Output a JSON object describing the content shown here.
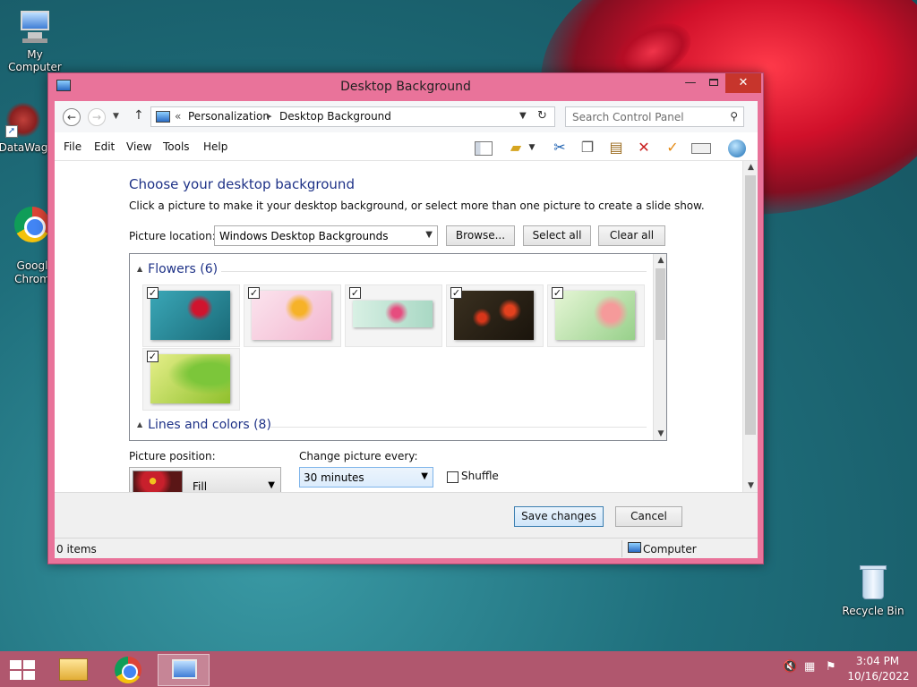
{
  "desktop": {
    "icons": [
      {
        "label": "My Computer"
      },
      {
        "label": "DataWag"
      },
      {
        "label": "Googl\nChrom"
      },
      {
        "label": "Recycle Bin"
      }
    ]
  },
  "window": {
    "title": "Desktop Background",
    "controls": {
      "minimize": "—",
      "close": "✕"
    }
  },
  "address_bar": {
    "separator": "«",
    "breadcrumbs": [
      "Personalization",
      "Desktop Background"
    ],
    "search_placeholder": "Search Control Panel"
  },
  "menu": [
    "File",
    "Edit",
    "View",
    "Tools",
    "Help"
  ],
  "toolbar_icons": [
    "preview-pane-icon",
    "folder-options-icon",
    "cut-icon",
    "copy-icon",
    "paste-icon",
    "delete-icon",
    "checkmark-icon",
    "rename-icon",
    "globe-icon"
  ],
  "content": {
    "heading": "Choose your desktop background",
    "description": "Click a picture to make it your desktop background, or select more than one picture to create a slide show.",
    "picture_location_label": "Picture location:",
    "picture_location_value": "Windows Desktop Backgrounds",
    "browse_label": "Browse...",
    "select_all_label": "Select all",
    "clear_all_label": "Clear all",
    "groups": [
      {
        "name": "Flowers (6)",
        "expanded": true,
        "items_checked": [
          true,
          true,
          true,
          true,
          true,
          true
        ]
      },
      {
        "name": "Lines and colors (8)",
        "expanded": true
      }
    ],
    "picture_position_label": "Picture position:",
    "picture_position_value": "Fill",
    "change_picture_label": "Change picture every:",
    "change_picture_value": "30 minutes",
    "shuffle_label": "Shuffle",
    "shuffle_checked": false
  },
  "footer": {
    "save_label": "Save changes",
    "cancel_label": "Cancel"
  },
  "status_bar": {
    "count": "0 items",
    "location": "Computer"
  },
  "taskbar": {
    "time": "3:04 PM",
    "date": "10/16/2022"
  },
  "colors": {
    "window_frame": "#e9739a",
    "taskbar": "#b0576e",
    "heading": "#1e3287",
    "close_button": "#c7352c"
  }
}
